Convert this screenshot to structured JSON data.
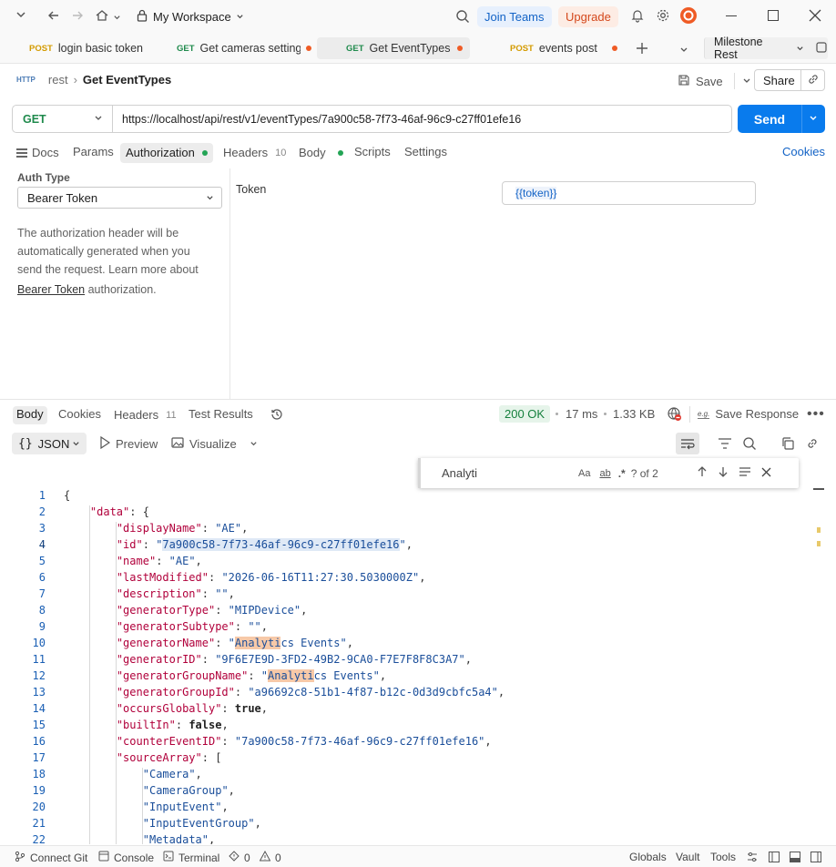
{
  "titlebar": {
    "workspace": "My Workspace",
    "join_teams": "Join Teams",
    "upgrade": "Upgrade"
  },
  "tabs": [
    {
      "method": "POST",
      "label": "login basic token",
      "method_color": "#e6a300",
      "dirty": false
    },
    {
      "method": "GET",
      "label": "Get cameras settings",
      "method_color": "#1f8a4c",
      "dirty": true
    },
    {
      "method": "GET",
      "label": "Get EventTypes",
      "method_color": "#1f8a4c",
      "dirty": true,
      "active": true
    },
    {
      "method": "POST",
      "label": "events post",
      "method_color": "#e6a300",
      "dirty": true
    }
  ],
  "environment": "Milestone Rest",
  "breadcrumb": {
    "icon_text": "HTTP",
    "parent": "rest",
    "title": "Get EventTypes"
  },
  "actions": {
    "save": "Save",
    "share": "Share"
  },
  "request": {
    "method": "GET",
    "url": "https://localhost/api/rest/v1/eventTypes/7a900c58-7f73-46af-96c9-c27ff01efe16",
    "send": "Send"
  },
  "req_tabs": {
    "docs": "Docs",
    "params": "Params",
    "authorization": "Authorization",
    "headers": "Headers",
    "headers_count": "10",
    "body": "Body",
    "scripts": "Scripts",
    "settings": "Settings",
    "cookies": "Cookies"
  },
  "auth": {
    "label": "Auth Type",
    "type": "Bearer Token",
    "desc1": "The authorization header will be",
    "desc2": "automatically generated when you",
    "desc3": "send the request. Learn more about",
    "link": "Bearer Token",
    "desc4": "authorization.",
    "token_label": "Token",
    "token_value": "{{token}}"
  },
  "resp_tabs": {
    "body": "Body",
    "cookies": "Cookies",
    "headers": "Headers",
    "headers_count": "11",
    "tests": "Test Results"
  },
  "resp_meta": {
    "status": "200 OK",
    "time": "17 ms",
    "size": "1.33 KB",
    "save_response": "Save Response"
  },
  "resp_toolbar": {
    "format": "JSON",
    "preview": "Preview",
    "visualize": "Visualize"
  },
  "find": {
    "query": "Analyti",
    "case": "Aa",
    "word": "ab",
    "regex": ".*",
    "count": "? of 2"
  },
  "code_lines": [
    {
      "n": "1",
      "segs": [
        {
          "t": "{",
          "c": ""
        }
      ]
    },
    {
      "n": "2",
      "i": 1,
      "segs": [
        {
          "t": "\"data\"",
          "c": "k"
        },
        {
          "t": ": {",
          "c": ""
        }
      ]
    },
    {
      "n": "3",
      "i": 2,
      "segs": [
        {
          "t": "\"displayName\"",
          "c": "k"
        },
        {
          "t": ": ",
          "c": ""
        },
        {
          "t": "\"AE\"",
          "c": "s"
        },
        {
          "t": ",",
          "c": ""
        }
      ]
    },
    {
      "n": "4",
      "i": 2,
      "segs": [
        {
          "t": "\"id\"",
          "c": "k"
        },
        {
          "t": ": ",
          "c": ""
        },
        {
          "t": "\"",
          "c": "s"
        },
        {
          "t": "7a900c58-7f73-46af-96c9-c27ff01efe16",
          "c": "s hlid"
        },
        {
          "t": "\"",
          "c": "s"
        },
        {
          "t": ",",
          "c": ""
        }
      ]
    },
    {
      "n": "5",
      "i": 2,
      "segs": [
        {
          "t": "\"name\"",
          "c": "k"
        },
        {
          "t": ": ",
          "c": ""
        },
        {
          "t": "\"AE\"",
          "c": "s"
        },
        {
          "t": ",",
          "c": ""
        }
      ]
    },
    {
      "n": "6",
      "i": 2,
      "segs": [
        {
          "t": "\"lastModified\"",
          "c": "k"
        },
        {
          "t": ": ",
          "c": ""
        },
        {
          "t": "\"2026-06-16T11:27:30.5030000Z\"",
          "c": "s"
        },
        {
          "t": ",",
          "c": ""
        }
      ]
    },
    {
      "n": "7",
      "i": 2,
      "segs": [
        {
          "t": "\"description\"",
          "c": "k"
        },
        {
          "t": ": ",
          "c": ""
        },
        {
          "t": "\"\"",
          "c": "s"
        },
        {
          "t": ",",
          "c": ""
        }
      ]
    },
    {
      "n": "8",
      "i": 2,
      "segs": [
        {
          "t": "\"generatorType\"",
          "c": "k"
        },
        {
          "t": ": ",
          "c": ""
        },
        {
          "t": "\"MIPDevice\"",
          "c": "s"
        },
        {
          "t": ",",
          "c": ""
        }
      ]
    },
    {
      "n": "9",
      "i": 2,
      "segs": [
        {
          "t": "\"generatorSubtype\"",
          "c": "k"
        },
        {
          "t": ": ",
          "c": ""
        },
        {
          "t": "\"\"",
          "c": "s"
        },
        {
          "t": ",",
          "c": ""
        }
      ]
    },
    {
      "n": "10",
      "i": 2,
      "segs": [
        {
          "t": "\"generatorName\"",
          "c": "k"
        },
        {
          "t": ": ",
          "c": ""
        },
        {
          "t": "\"",
          "c": "s"
        },
        {
          "t": "Analyti",
          "c": "s hl"
        },
        {
          "t": "cs Events\"",
          "c": "s"
        },
        {
          "t": ",",
          "c": ""
        }
      ]
    },
    {
      "n": "11",
      "i": 2,
      "segs": [
        {
          "t": "\"generatorID\"",
          "c": "k"
        },
        {
          "t": ": ",
          "c": ""
        },
        {
          "t": "\"9F6E7E9D-3FD2-49B2-9CA0-F7E7F8F8C3A7\"",
          "c": "s"
        },
        {
          "t": ",",
          "c": ""
        }
      ]
    },
    {
      "n": "12",
      "i": 2,
      "segs": [
        {
          "t": "\"generatorGroupName\"",
          "c": "k"
        },
        {
          "t": ": ",
          "c": ""
        },
        {
          "t": "\"",
          "c": "s"
        },
        {
          "t": "Analyti",
          "c": "s hl"
        },
        {
          "t": "cs Events\"",
          "c": "s"
        },
        {
          "t": ",",
          "c": ""
        }
      ]
    },
    {
      "n": "13",
      "i": 2,
      "segs": [
        {
          "t": "\"generatorGroupId\"",
          "c": "k"
        },
        {
          "t": ": ",
          "c": ""
        },
        {
          "t": "\"a96692c8-51b1-4f87-b12c-0d3d9cbfc5a4\"",
          "c": "s"
        },
        {
          "t": ",",
          "c": ""
        }
      ]
    },
    {
      "n": "14",
      "i": 2,
      "segs": [
        {
          "t": "\"occursGlobally\"",
          "c": "k"
        },
        {
          "t": ": ",
          "c": ""
        },
        {
          "t": "true",
          "c": "b"
        },
        {
          "t": ",",
          "c": ""
        }
      ]
    },
    {
      "n": "15",
      "i": 2,
      "segs": [
        {
          "t": "\"builtIn\"",
          "c": "k"
        },
        {
          "t": ": ",
          "c": ""
        },
        {
          "t": "false",
          "c": "b"
        },
        {
          "t": ",",
          "c": ""
        }
      ]
    },
    {
      "n": "16",
      "i": 2,
      "segs": [
        {
          "t": "\"counterEventID\"",
          "c": "k"
        },
        {
          "t": ": ",
          "c": ""
        },
        {
          "t": "\"7a900c58-7f73-46af-96c9-c27ff01efe16\"",
          "c": "s"
        },
        {
          "t": ",",
          "c": ""
        }
      ]
    },
    {
      "n": "17",
      "i": 2,
      "segs": [
        {
          "t": "\"sourceArray\"",
          "c": "k"
        },
        {
          "t": ": [",
          "c": ""
        }
      ]
    },
    {
      "n": "18",
      "i": 3,
      "segs": [
        {
          "t": "\"Camera\"",
          "c": "s"
        },
        {
          "t": ",",
          "c": ""
        }
      ]
    },
    {
      "n": "19",
      "i": 3,
      "segs": [
        {
          "t": "\"CameraGroup\"",
          "c": "s"
        },
        {
          "t": ",",
          "c": ""
        }
      ]
    },
    {
      "n": "20",
      "i": 3,
      "segs": [
        {
          "t": "\"InputEvent\"",
          "c": "s"
        },
        {
          "t": ",",
          "c": ""
        }
      ]
    },
    {
      "n": "21",
      "i": 3,
      "segs": [
        {
          "t": "\"InputEventGroup\"",
          "c": "s"
        },
        {
          "t": ",",
          "c": ""
        }
      ]
    },
    {
      "n": "22",
      "i": 3,
      "segs": [
        {
          "t": "\"Metadata\"",
          "c": "s"
        },
        {
          "t": ",",
          "c": ""
        }
      ]
    }
  ],
  "statusbar": {
    "connect_git": "Connect Git",
    "console": "Console",
    "terminal": "Terminal",
    "errors": "0",
    "warnings": "0",
    "globals": "Globals",
    "vault": "Vault",
    "tools": "Tools"
  }
}
